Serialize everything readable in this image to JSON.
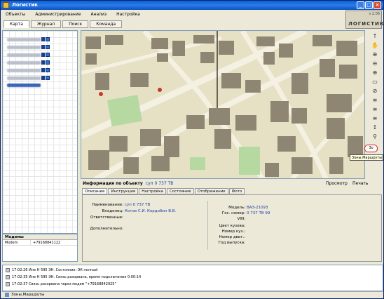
{
  "window": {
    "title": "Логистик",
    "minimize": "_",
    "maximize": "□",
    "close": "×"
  },
  "menu": {
    "items": [
      "Объекты",
      "Администрирование",
      "Анализ",
      "Настройка"
    ]
  },
  "logo": {
    "version": "v 2.06",
    "name": "ЛОГИСТИКА"
  },
  "toolbar": {
    "tabs": [
      "Карта",
      "Журнал",
      "Поиск",
      "Команда"
    ]
  },
  "props": {
    "header": "Модемы",
    "rows": [
      {
        "key": "Modem",
        "value": "+79168841122"
      }
    ]
  },
  "maptools": [
    "↑",
    "✋",
    "⊕",
    "⊖",
    "⊕",
    "▭",
    "⊘",
    "≡",
    "≡",
    "≡",
    "↕",
    "⚲"
  ],
  "zone": {
    "button": "Зо",
    "tooltip": "Зоны,Маршруты"
  },
  "info": {
    "header_label": "Информация по объекту",
    "header_value": "суп 0 737 ТВ",
    "view_button": "Просмотр",
    "print_button": "Печать",
    "tabs": [
      "Описание",
      "Инструкция",
      "Настройка",
      "Состояние",
      "Отображение",
      "Фото"
    ],
    "left_fields": [
      {
        "key": "Наименование:",
        "value": "суп 0 737 ТВ"
      },
      {
        "key": "Владелец:",
        "value": "Котов С.И. Кордобин В.В."
      },
      {
        "key": "Ответственные:",
        "value": ""
      },
      {
        "key": "Дополнительно:",
        "value": ""
      }
    ],
    "right_fields": [
      {
        "key": "Модель:",
        "value": "ВАЗ-21093"
      },
      {
        "key": "Гос. номер:",
        "value": "0 737 ТВ 99"
      },
      {
        "key": "VIN:",
        "value": ""
      },
      {
        "key": "Цвет кузова:",
        "value": ""
      },
      {
        "key": "Номер куз.:",
        "value": ""
      },
      {
        "key": "Номер двиг.:",
        "value": ""
      },
      {
        "key": "Год выпуска:",
        "value": ""
      }
    ]
  },
  "log": {
    "lines": [
      "17:02:26   Ине Н 595 ЭН. Состояние: ЭК полный",
      "17:02:35   Ине Н 595 ЭН. Связь разорвана, время подключения 0:00:14",
      "17:02:37   Связь разорвана через модем \"+79168842925\""
    ]
  },
  "status": {
    "text": "Зоны,Маршруты"
  }
}
